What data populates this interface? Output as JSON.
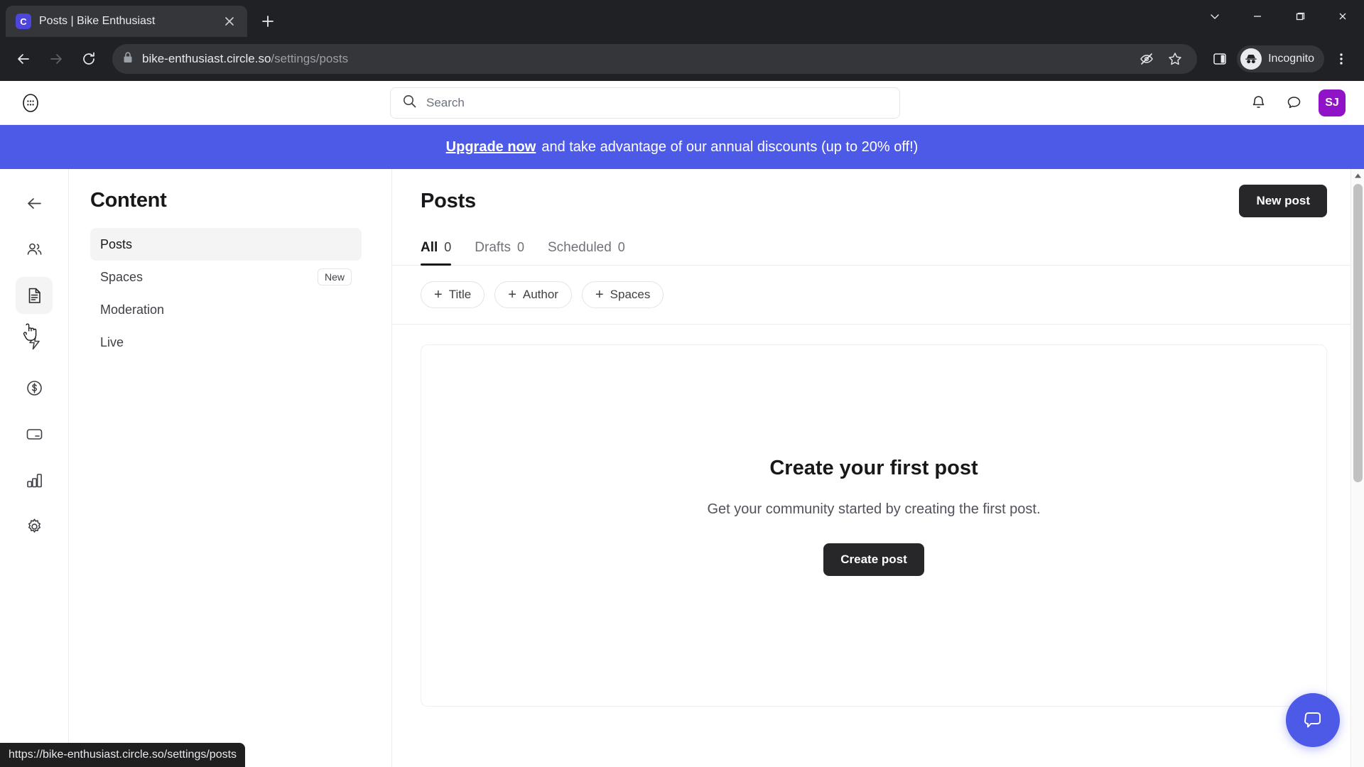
{
  "browser": {
    "tab": {
      "title": "Posts | Bike Enthusiast",
      "favicon_letter": "C",
      "favicon_color": "#4e46dc"
    },
    "new_tab_icon": "plus-icon",
    "window_controls": [
      "tab-search-chevron-icon",
      "minimize-icon",
      "maximize-icon",
      "close-icon"
    ],
    "nav": {
      "back": "back-arrow-icon",
      "forward": "forward-arrow-icon",
      "reload": "reload-icon"
    },
    "omnibox": {
      "lock_icon": "lock-icon",
      "domain": "bike-enthusiast.circle.so",
      "path": "/settings/posts",
      "eye_off_icon": "eye-off-icon",
      "bookmark_icon": "star-icon"
    },
    "side_panel_icon": "side-panel-icon",
    "incognito_label": "Incognito",
    "menu_icon": "three-dot-menu-icon",
    "status_url": "https://bike-enthusiast.circle.so/settings/posts"
  },
  "app": {
    "logo": "circle-logo-icon",
    "search": {
      "placeholder": "Search",
      "icon": "search-icon"
    },
    "notifications_icon": "bell-icon",
    "messages_icon": "chat-bubble-icon",
    "avatar_initials": "SJ",
    "avatar_color": "#9013c7"
  },
  "banner": {
    "link_text": "Upgrade now",
    "text": "and take advantage of our annual discounts (up to 20% off!)",
    "color": "#4d5ae8"
  },
  "rail": {
    "items": [
      {
        "name": "back-arrow-icon",
        "active": false
      },
      {
        "name": "members-icon",
        "active": false
      },
      {
        "name": "content-document-icon",
        "active": true
      },
      {
        "name": "lightning-icon",
        "active": false
      },
      {
        "name": "dollar-circle-icon",
        "active": false
      },
      {
        "name": "card-icon",
        "active": false
      },
      {
        "name": "analytics-bar-chart-icon",
        "active": false
      },
      {
        "name": "settings-gear-icon",
        "active": false
      }
    ]
  },
  "sidebar": {
    "heading": "Content",
    "items": [
      {
        "label": "Posts",
        "badge": "",
        "active": true
      },
      {
        "label": "Spaces",
        "badge": "New",
        "active": false
      },
      {
        "label": "Moderation",
        "badge": "",
        "active": false
      },
      {
        "label": "Live",
        "badge": "",
        "active": false
      }
    ]
  },
  "main": {
    "title": "Posts",
    "new_post_label": "New post",
    "tabs": [
      {
        "label": "All",
        "count": "0",
        "active": true
      },
      {
        "label": "Drafts",
        "count": "0",
        "active": false
      },
      {
        "label": "Scheduled",
        "count": "0",
        "active": false
      }
    ],
    "filters": [
      {
        "label": "Title"
      },
      {
        "label": "Author"
      },
      {
        "label": "Spaces"
      }
    ],
    "empty_state": {
      "heading": "Create your first post",
      "subtext": "Get your community started by creating the first post.",
      "button_label": "Create post"
    }
  },
  "fab": {
    "icon": "chat-bubble-icon",
    "color": "#4d5ae8"
  }
}
